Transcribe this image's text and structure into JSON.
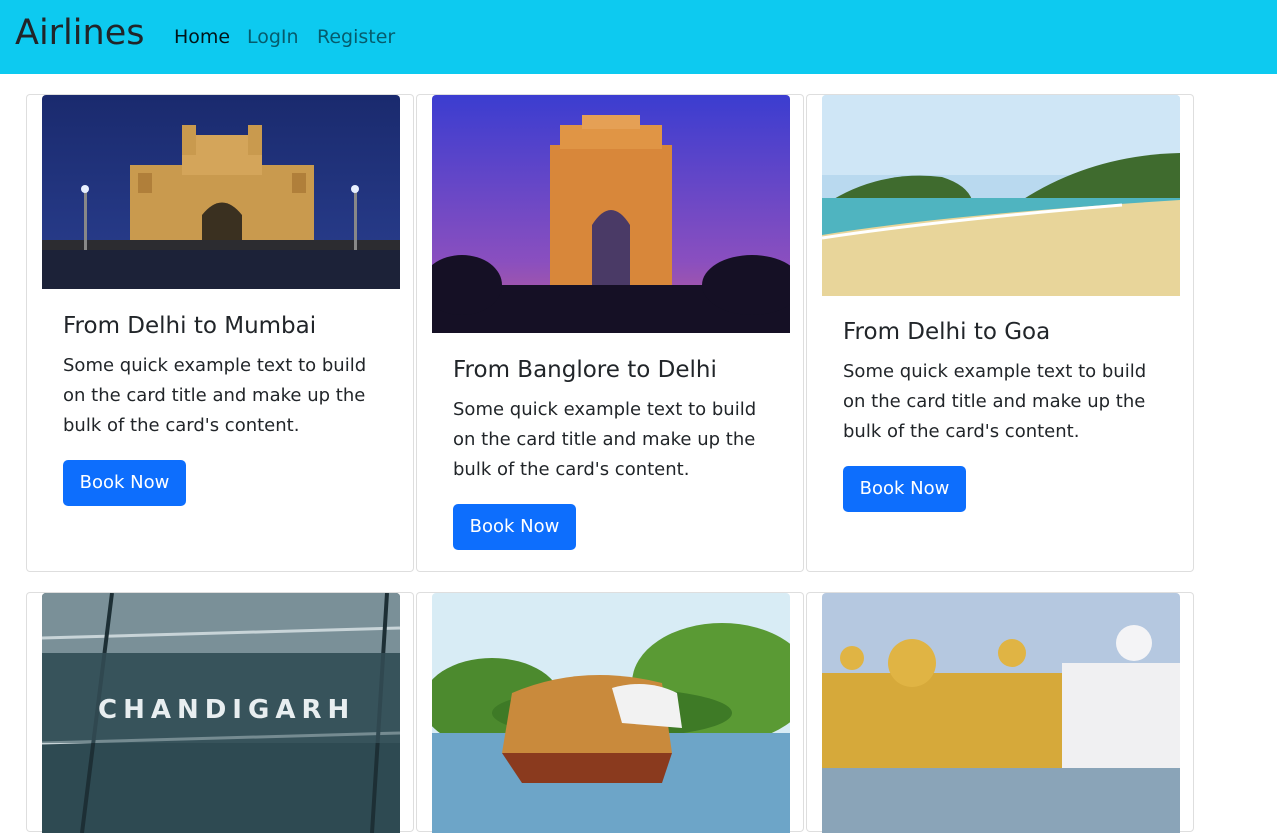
{
  "navbar": {
    "brand": "Airlines",
    "links": [
      {
        "label": "Home"
      },
      {
        "label": "LogIn"
      },
      {
        "label": "Register"
      }
    ]
  },
  "cards": [
    {
      "title": "From Delhi to Mumbai",
      "text": "Some quick example text to build on the card title and make up the bulk of the card's content.",
      "button": "Book Now"
    },
    {
      "title": "From Banglore to Delhi",
      "text": "Some quick example text to build on the card title and make up the bulk of the card's content.",
      "button": "Book Now"
    },
    {
      "title": "From Delhi to Goa",
      "text": "Some quick example text to build on the card title and make up the bulk of the card's content.",
      "button": "Book Now"
    },
    {
      "image_sign_text": "CHANDIGARH"
    },
    {},
    {}
  ],
  "colors": {
    "navbar_bg": "#0dcaf0",
    "button_bg": "#0d6efd",
    "text": "#212529"
  }
}
